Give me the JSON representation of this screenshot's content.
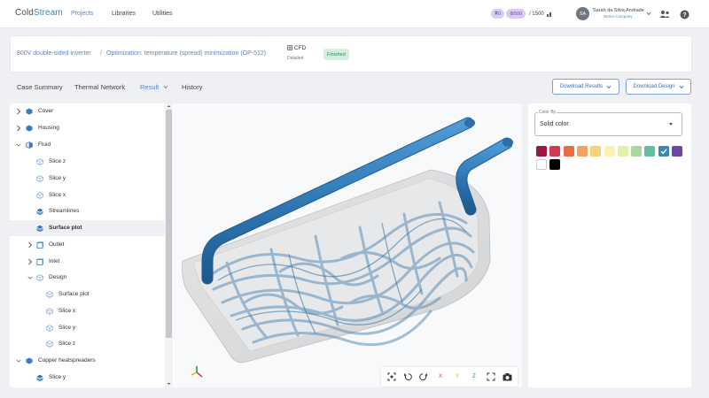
{
  "app": {
    "logo_a": "Cold",
    "logo_b": "Stream",
    "nav": [
      "Projects",
      "Libraries",
      "Utilities"
    ],
    "credits": {
      "pill1": "0",
      "pill2": "500",
      "total": "/ 1500"
    },
    "user": {
      "initials": "SA",
      "name": "Sarah da Silva Andrade",
      "company": "Demo Company"
    }
  },
  "breadcrumb": {
    "project": "800V double-sided inverter",
    "separator": "/",
    "study": "Optimization: temperature (spread) minimization (OP-512)",
    "type": "CFD",
    "type_sub": "Detailed",
    "status": "Finished"
  },
  "tabs": [
    "Case Summary",
    "Thermal Network",
    "Result",
    "History"
  ],
  "buttons": {
    "download_results": "Download Results",
    "download_design": "Download Design"
  },
  "tree": [
    {
      "label": "Cover",
      "level": 0,
      "chev": "right",
      "icon": "cube-solid"
    },
    {
      "label": "Housing",
      "level": 0,
      "chev": "right",
      "icon": "cube-solid"
    },
    {
      "label": "Fluid",
      "level": 0,
      "chev": "down",
      "icon": "cube-half"
    },
    {
      "label": "Slice z",
      "level": 1,
      "chev": "",
      "icon": "cube-outline"
    },
    {
      "label": "Slice y",
      "level": 1,
      "chev": "",
      "icon": "cube-outline"
    },
    {
      "label": "Slice x",
      "level": 1,
      "chev": "",
      "icon": "cube-outline"
    },
    {
      "label": "Streamlines",
      "level": 1,
      "chev": "",
      "icon": "layers"
    },
    {
      "label": "Surface plot",
      "level": 1,
      "chev": "",
      "icon": "layers",
      "selected": true
    },
    {
      "label": "Outlet",
      "level": 1,
      "chev": "right",
      "icon": "box-outline"
    },
    {
      "label": "Inlet",
      "level": 1,
      "chev": "right",
      "icon": "box-outline"
    },
    {
      "label": "Design",
      "level": 1,
      "chev": "down",
      "icon": "cube-outline"
    },
    {
      "label": "Surface plot",
      "level": 2,
      "chev": "",
      "icon": "cube-outline"
    },
    {
      "label": "Slice x",
      "level": 2,
      "chev": "",
      "icon": "cube-outline"
    },
    {
      "label": "Slice y",
      "level": 2,
      "chev": "",
      "icon": "cube-outline"
    },
    {
      "label": "Slice z",
      "level": 2,
      "chev": "",
      "icon": "cube-outline"
    },
    {
      "label": "Copper heatspreaders",
      "level": 0,
      "chev": "down",
      "icon": "cube-solid"
    },
    {
      "label": "Slice y",
      "level": 1,
      "chev": "",
      "icon": "layers"
    }
  ],
  "viewer": {
    "axes": [
      "X",
      "Y",
      "Z"
    ],
    "axis_colors": {
      "x": "#d23a3a",
      "y": "#d8b400",
      "z": "#2a8a3a"
    }
  },
  "color_panel": {
    "label": "Color By",
    "value": "Solid color",
    "swatches": [
      "#9c1746",
      "#d23b4f",
      "#ec6b3f",
      "#f4a25a",
      "#f7d17a",
      "#fbf1b0",
      "#e4f0a6",
      "#a9d89c",
      "#64bd9f",
      "#3c86b6",
      "#6a47a2",
      "#ffffff",
      "#000000"
    ],
    "selected_swatch": "#3c86b6"
  }
}
